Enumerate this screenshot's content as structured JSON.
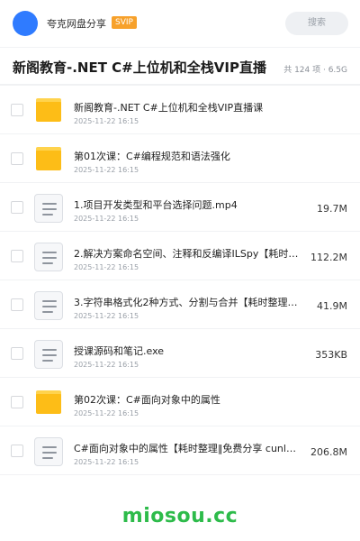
{
  "header": {
    "user_name": "夸克网盘分享",
    "badge": "SVIP",
    "search_label": "搜索"
  },
  "folder_title": "新阁教育-.NET C#上位机和全栈VIP直播",
  "folder_meta": "共 124 项 · 6.5G",
  "items": [
    {
      "type": "folder",
      "name": "新阁教育-.NET C#上位机和全栈VIP直播课",
      "date": "2025-11-22 16:15",
      "size": ""
    },
    {
      "type": "folder",
      "name": "第01次课：C#编程规范和语法强化",
      "date": "2025-11-22 16:15",
      "size": ""
    },
    {
      "type": "file",
      "name": "1.项目开发类型和平台选择问题.mp4",
      "date": "2025-11-22 16:15",
      "size": "19.7M"
    },
    {
      "type": "file",
      "name": "2.解决方案命名空间、注释和反编译ILSpy【耗时…",
      "date": "2025-11-22 16:15",
      "size": "112.2M"
    },
    {
      "type": "file",
      "name": "3.字符串格式化2种方式、分割与合并【耗时整理‖免…",
      "date": "2025-11-22 16:15",
      "size": "41.9M"
    },
    {
      "type": "file",
      "name": "授课源码和笔记.exe",
      "date": "2025-11-22 16:15",
      "size": "353KB"
    },
    {
      "type": "folder",
      "name": "第02次课：C#面向对象中的属性",
      "date": "2025-11-22 16:15",
      "size": ""
    },
    {
      "type": "file",
      "name": "C#面向对象中的属性【耗时整理‖免费分享 cunl…",
      "date": "2025-11-22 16:15",
      "size": "206.8M"
    }
  ],
  "watermark": "miosou.cc",
  "colors": {
    "accent": "#2f7bff",
    "svip": "#f7a12b",
    "folder": "#fdbd17",
    "watermark": "#2dbb4a"
  }
}
